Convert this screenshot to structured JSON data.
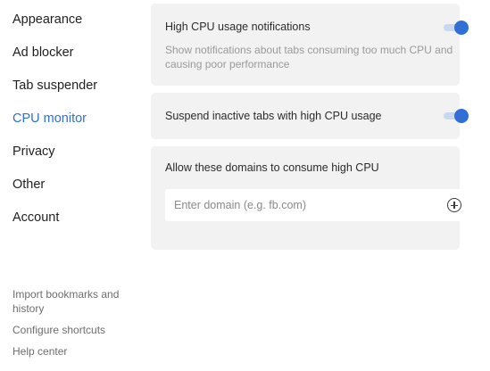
{
  "sidebar": {
    "items": [
      {
        "label": "Appearance",
        "active": false
      },
      {
        "label": "Ad blocker",
        "active": false
      },
      {
        "label": "Tab suspender",
        "active": false
      },
      {
        "label": "CPU monitor",
        "active": true
      },
      {
        "label": "Privacy",
        "active": false
      },
      {
        "label": "Other",
        "active": false
      },
      {
        "label": "Account",
        "active": false
      }
    ],
    "footer": {
      "import_label": "Import bookmarks and history",
      "shortcuts_label": "Configure shortcuts",
      "help_label": "Help center"
    }
  },
  "settings": {
    "high_cpu_notifications": {
      "title": "High CPU usage notifications",
      "description": "Show notifications about tabs consuming too much CPU and causing poor performance",
      "enabled": true
    },
    "suspend_inactive": {
      "title": "Suspend inactive tabs with high CPU usage",
      "enabled": true
    },
    "allowed_domains": {
      "title": "Allow these domains to consume high CPU",
      "input_value": "",
      "input_placeholder": "Enter domain (e.g. fb.com)"
    }
  },
  "colors": {
    "accent": "#2f6fd6",
    "card_background": "#f2f2f2",
    "toggle_track": "#c9d8ee",
    "muted_text": "#9a9a9a"
  },
  "icons": {
    "add_domain": "plus-circle-icon",
    "toggle": "toggle-switch-icon"
  }
}
